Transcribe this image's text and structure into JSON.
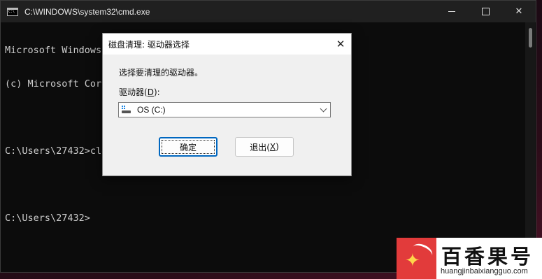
{
  "cmd_window": {
    "title": "C:\\WINDOWS\\system32\\cmd.exe",
    "controls": {
      "close": "✕"
    },
    "console_lines": [
      "Microsoft Windows [版本 10.0.22000.194]",
      "(c) Microsoft Corporation。保留所有权利。",
      "",
      "C:\\Users\\27432>cleanmgr",
      "",
      "C:\\Users\\27432>"
    ]
  },
  "dialog": {
    "title": "磁盘清理: 驱动器选择",
    "close": "✕",
    "prompt": "选择要清理的驱动器。",
    "drives_label_prefix": "驱动器(",
    "drives_label_key": "D",
    "drives_label_suffix": "):",
    "selected_drive": "OS (C:)",
    "ok_button": "确定",
    "exit_button_prefix": "退出(",
    "exit_button_key": "X",
    "exit_button_suffix": ")"
  },
  "watermark": {
    "title": "百香果号",
    "subtitle": "huangjinbaixiangguo.com"
  },
  "icons": {
    "app": "cmd-icon",
    "drive": "drive-icon",
    "dropdown": "chevron-down-icon"
  }
}
